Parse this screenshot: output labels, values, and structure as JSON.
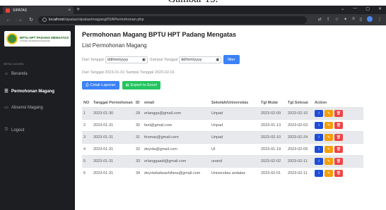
{
  "caption": "Gambar 15.",
  "browser": {
    "tab_title": "SIPATAS",
    "tab_close": "×",
    "new_tab": "+",
    "url_host": "localhost",
    "url_path": "/sipatas/sipatas/magang/02APermohonan.php"
  },
  "sidebar": {
    "logo_main": "BPTU HPT PADANG MENGATAS",
    "logo_sub": "SISTEM INFORMASI MAGANG",
    "section_label": "MENU ADMIN",
    "items": [
      {
        "label": "Beranda",
        "icon": "home-icon"
      },
      {
        "label": "Permohonan Magang",
        "icon": "list-icon",
        "active": true
      },
      {
        "label": "Absensi Magang",
        "icon": "clipboard-icon"
      },
      {
        "label": "Logout",
        "icon": "logout-icon"
      }
    ]
  },
  "main": {
    "title": "Permohonan Magang BPTU HPT Padang Mengatas",
    "subtitle": "List Permohonan Magang",
    "filter": {
      "from_label": "Dari Tanggal",
      "to_label": "Sampai Tanggal",
      "date_placeholder": "dd/mm/yyyy",
      "button": "filter"
    },
    "range_text": "Dari Tanggal 2023-01-01 Sampai Tanggal 2023-02-01",
    "print_button": "Cetak Laporan",
    "excel_button": "Export to Excel",
    "table": {
      "headers": [
        "NO",
        "Tanggal Permohonan",
        "ID",
        "email",
        "Sekolah/Universitas",
        "Tgl Mulai",
        "Tgl Selesai",
        "Action"
      ],
      "rows": [
        {
          "no": "1",
          "tanggal": "2023-01-30",
          "id": "29",
          "email": "erlangga@gmail.com",
          "sekolah": "Unpad",
          "mulai": "2023-02-09",
          "selesai": "2023-02-10"
        },
        {
          "no": "2",
          "tanggal": "2023-01-31",
          "id": "30",
          "email": "fani@gmail.com",
          "sekolah": "Unpad",
          "mulai": "2023-01-13",
          "selesai": "2023-02-03"
        },
        {
          "no": "3",
          "tanggal": "2023-01-31",
          "id": "31",
          "email": "thomas@gmail.com",
          "sekolah": "Unpad",
          "mulai": "2023-02-10",
          "selesai": "2023-02-24"
        },
        {
          "no": "4",
          "tanggal": "2023-01-31",
          "id": "32",
          "email": "deyola@gmail.com",
          "sekolah": "UI",
          "mulai": "2023-01-19",
          "selesai": "2023-02-09"
        },
        {
          "no": "5",
          "tanggal": "2023-01-31",
          "id": "33",
          "email": "erlanggaadi@gmail.com",
          "sekolah": "unand",
          "mulai": "2023-02-02",
          "selesai": "2023-02-11"
        },
        {
          "no": "6",
          "tanggal": "2023-01-31",
          "id": "34",
          "email": "deyolafadwashifana@gmail.com",
          "sekolah": "Universitas andalas",
          "mulai": "2023-02-01",
          "selesai": "2023-02-11"
        }
      ],
      "actions": {
        "info": "i",
        "edit": "✎",
        "delete": "🗑"
      }
    }
  },
  "colors": {
    "sidebar_bg": "#1c1e21",
    "primary": "#3b82f6",
    "success": "#22c55e",
    "info": "#1d4ed8",
    "warning": "#f59e0b",
    "danger": "#ef4444"
  }
}
